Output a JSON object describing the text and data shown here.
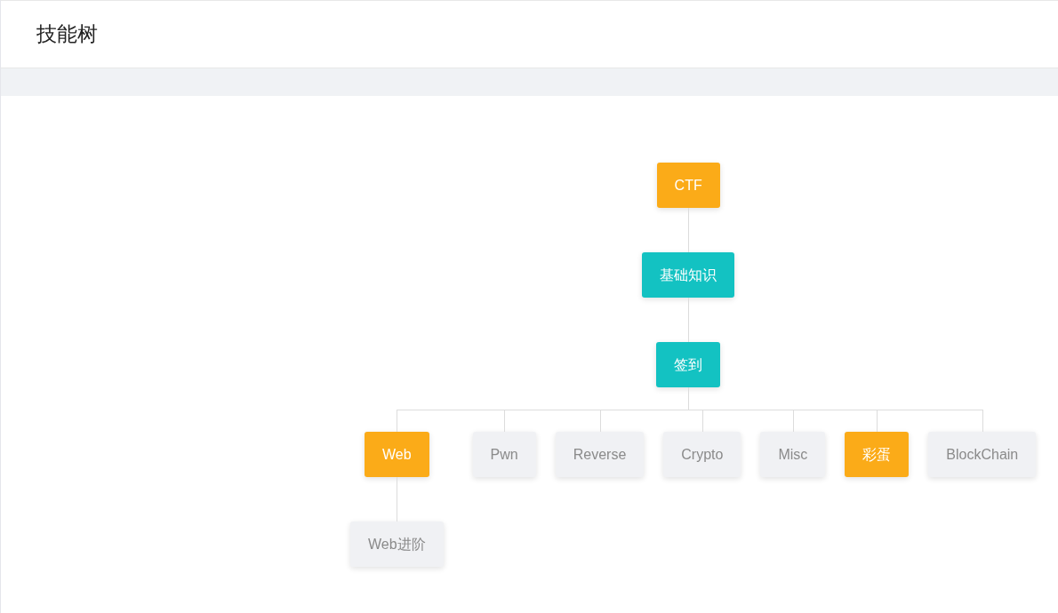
{
  "header": {
    "title": "技能树"
  },
  "tree": {
    "label": "CTF",
    "color": "#fbab18",
    "children": [
      {
        "label": "基础知识",
        "color": "#13c2c2",
        "children": [
          {
            "label": "签到",
            "color": "#13c2c2",
            "children": [
              {
                "label": "Web",
                "color": "#fbab18",
                "children": [
                  {
                    "label": "Web进阶",
                    "color": "#f0f1f4"
                  }
                ]
              },
              {
                "label": "Pwn",
                "color": "#f0f1f4"
              },
              {
                "label": "Reverse",
                "color": "#f0f1f4"
              },
              {
                "label": "Crypto",
                "color": "#f0f1f4"
              },
              {
                "label": "Misc",
                "color": "#f0f1f4"
              },
              {
                "label": "彩蛋",
                "color": "#fbab18"
              },
              {
                "label": "BlockChain",
                "color": "#f0f1f4"
              }
            ]
          }
        ]
      }
    ]
  }
}
